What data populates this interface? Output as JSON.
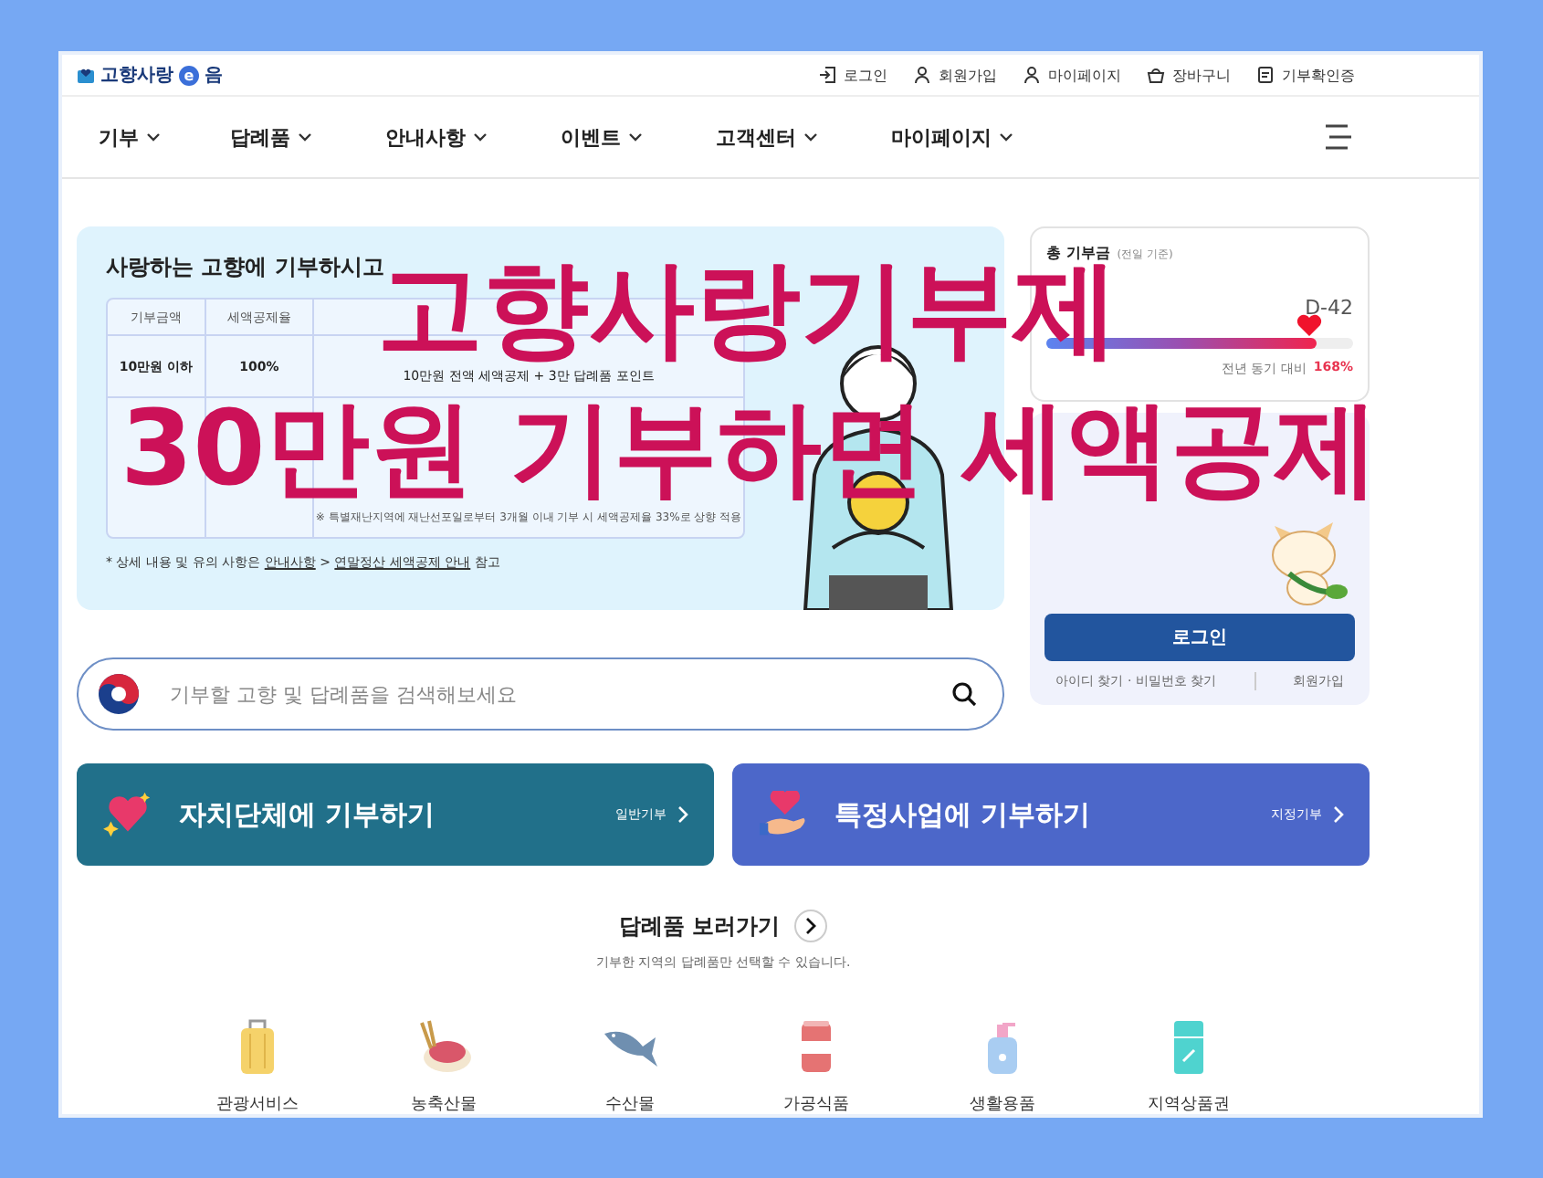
{
  "header": {
    "logo": {
      "name": "고향사랑",
      "mark": "e",
      "suffix": "음"
    },
    "utility_links": [
      "로그인",
      "회원가입",
      "마이페이지",
      "장바구니",
      "기부확인증"
    ]
  },
  "nav": {
    "items": [
      "기부",
      "답례품",
      "안내사항",
      "이벤트",
      "고객센터",
      "마이페이지"
    ]
  },
  "banner": {
    "heading": "사랑하는 고향에 기부하시고",
    "table": {
      "columns": [
        "기부금액",
        "세액공제율"
      ],
      "rows": [
        {
          "cells": [
            "10만원 이하",
            "100%"
          ],
          "benefit_detail": "10만원 전액 세액공제 + 3만 답례품 포인트"
        }
      ],
      "note": "※ 특별재난지역에 재난선포일로부터 3개월 이내 기부 시 세액공제율 33%로 상향 적용"
    },
    "footnote": {
      "prefix": "* 상세 내용 및 유의 사항은",
      "link1": "안내사항",
      "sep": ">",
      "link2": "연말정산 세액공제 안내",
      "suffix": "참고"
    }
  },
  "stats": {
    "label": "총 기부금",
    "basis": "(전일 기준)",
    "dday": "D-42",
    "level": 0.88,
    "comparison_label": "전년 동기 대비",
    "comparison_value": "168%"
  },
  "login": {
    "button": "로그인",
    "links": [
      "아이디 찾기 · 비밀번호 찾기",
      "회원가입"
    ]
  },
  "search": {
    "placeholder": "기부할 고향 및 답례품을 검색해보세요"
  },
  "donate_cards": [
    {
      "title": "자치단체에 기부하기",
      "link": "일반기부",
      "color": "#21708a"
    },
    {
      "title": "특정사업에 기부하기",
      "link": "지정기부",
      "color": "#4c67c9"
    }
  ],
  "gifts": {
    "title": "답례품 보러가기",
    "subtitle": "기부한 지역의 답례품만 선택할 수 있습니다.",
    "categories": [
      "관광서비스",
      "농축산물",
      "수산물",
      "가공식품",
      "생활용품",
      "지역상품권"
    ]
  },
  "overlay": {
    "lines": [
      "고향사랑기부제",
      "30만원 기부하면 세액공제"
    ]
  }
}
